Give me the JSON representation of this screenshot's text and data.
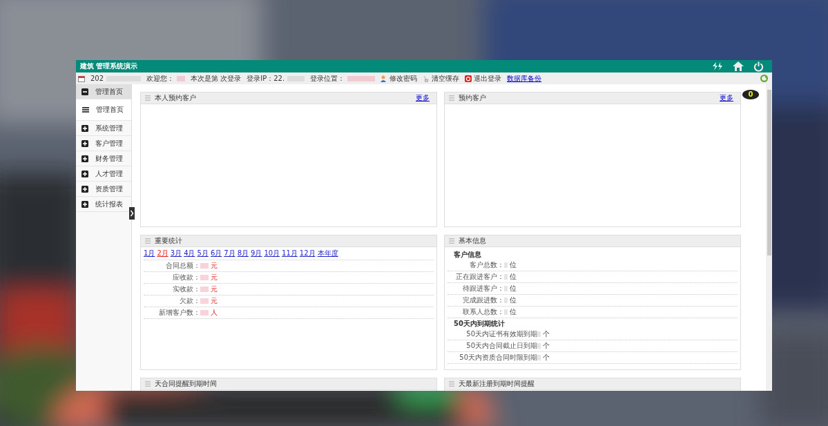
{
  "window": {
    "title_start": "建筑",
    "title_end": "管理系统演示"
  },
  "info_bar": {
    "date": "202",
    "welcome": "欢迎您：",
    "login_count_start": "本次是第",
    "login_count_end": "次登录",
    "ip": "登录IP：22.",
    "location": "登录位置：",
    "actions": [
      {
        "kind": "password",
        "label": "修改密码"
      },
      {
        "kind": "cache",
        "label": "清空缓存"
      },
      {
        "kind": "logout",
        "label": "退出登录"
      },
      {
        "kind": "backup",
        "label": "数据库备份"
      }
    ]
  },
  "notification_count": "0",
  "sidebar": {
    "items": [
      {
        "label": "管理首页",
        "expanded": true,
        "children": [
          {
            "label": "管理首页"
          }
        ]
      },
      {
        "label": "系统管理",
        "expanded": false
      },
      {
        "label": "客户管理",
        "expanded": false
      },
      {
        "label": "财务管理",
        "expanded": false
      },
      {
        "label": "人才管理",
        "expanded": false
      },
      {
        "label": "资质管理",
        "expanded": false
      },
      {
        "label": "统计报表",
        "expanded": false
      }
    ]
  },
  "panels": [
    {
      "kind": "empty",
      "title": "本人预约客户",
      "more": "更多"
    },
    {
      "kind": "empty",
      "title": "预约客户",
      "more": "更多"
    },
    {
      "kind": "stats",
      "title": "重要统计",
      "months": [
        {
          "label": "1月",
          "selected": false
        },
        {
          "label": "2月",
          "selected": true
        },
        {
          "label": "3月",
          "selected": false
        },
        {
          "label": "4月",
          "selected": false
        },
        {
          "label": "5月",
          "selected": false
        },
        {
          "label": "6月",
          "selected": false
        },
        {
          "label": "7月",
          "selected": false
        },
        {
          "label": "8月",
          "selected": false
        },
        {
          "label": "9月",
          "selected": false
        },
        {
          "label": "10月",
          "selected": false
        },
        {
          "label": "11月",
          "selected": false
        },
        {
          "label": "12月",
          "selected": false
        },
        {
          "label": "本年度",
          "selected": false
        }
      ],
      "rows": [
        {
          "label": "合同总额：",
          "unit": "元"
        },
        {
          "label": "应收款：",
          "unit": "元"
        },
        {
          "label": "实收款：",
          "unit": "元"
        },
        {
          "label": "欠款：",
          "unit": "元"
        },
        {
          "label": "新增客户数：",
          "unit": "人"
        }
      ]
    },
    {
      "kind": "info",
      "title": "基本信息",
      "sections": [
        {
          "heading": "客户信息",
          "rows": [
            {
              "label": "客户总数：",
              "unit": "位"
            },
            {
              "label": "正在跟进客户：",
              "unit": "位"
            },
            {
              "label": "待跟进客户：",
              "unit": "位"
            },
            {
              "label": "完成跟进数：",
              "unit": "位"
            },
            {
              "label": "联系人总数：",
              "unit": "位"
            }
          ]
        },
        {
          "heading": "50天内到期统计",
          "rows": [
            {
              "label": "50天内证书有效期到期",
              "unit": "个"
            },
            {
              "label": "50天内合同截止日到期",
              "unit": "个"
            },
            {
              "label": "50天内资质合同时限到期",
              "unit": "个"
            }
          ]
        }
      ]
    },
    {
      "kind": "cut",
      "title": "天合同提醒到期时间"
    },
    {
      "kind": "cut",
      "title": "天最新注册到期时间提醒"
    }
  ]
}
